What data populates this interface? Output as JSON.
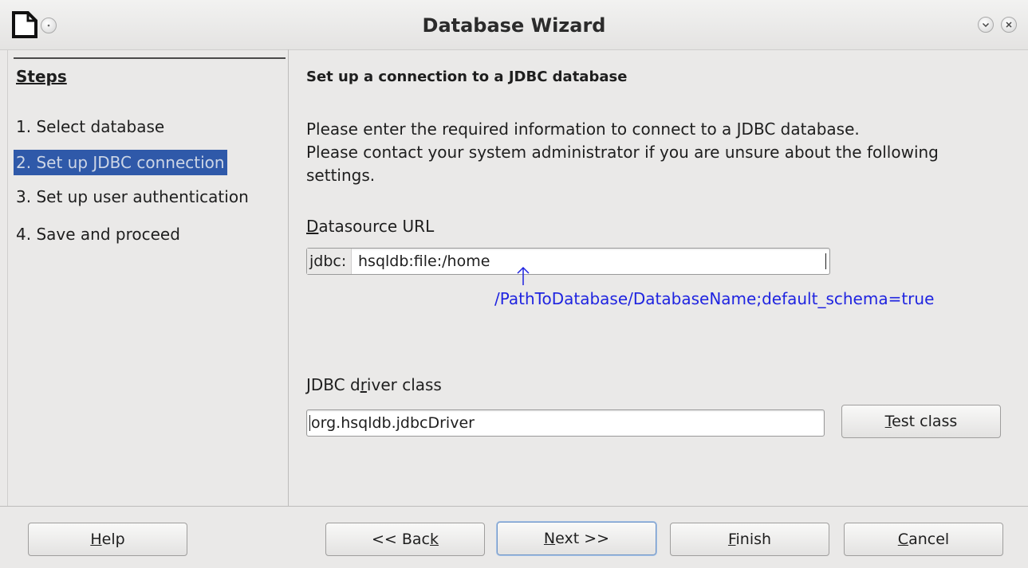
{
  "window": {
    "title": "Database Wizard"
  },
  "steps": {
    "heading": "Steps",
    "items": [
      {
        "label": "1. Select database"
      },
      {
        "label": "2. Set up JDBC connection",
        "selected": true
      },
      {
        "label": "3. Set up user authentication"
      },
      {
        "label": "4. Save and proceed"
      }
    ]
  },
  "panel": {
    "heading": "Set up a connection to a JDBC database",
    "intro_line1": "Please enter the required information to connect to a JDBC database.",
    "intro_line2": "Please contact your system administrator if you are unsure about the following",
    "intro_line3": "settings."
  },
  "datasource": {
    "label_mnemonic": "D",
    "label_rest": "atasource URL",
    "prefix": "jdbc:",
    "value": "hsqldb:file:/home",
    "annotation": "/PathToDatabase/DatabaseName;default_schema=true"
  },
  "driver": {
    "label_pre": "JDBC d",
    "label_mnemonic": "r",
    "label_post": "iver class",
    "value": "org.hsqldb.jdbcDriver",
    "test_mnemonic": "T",
    "test_rest": "est class"
  },
  "buttons": {
    "help_mnemonic": "H",
    "help_rest": "elp",
    "back_pre": "<< Bac",
    "back_mnemonic": "k",
    "next_mnemonic": "N",
    "next_rest": "ext >>",
    "finish_mnemonic": "F",
    "finish_rest": "inish",
    "cancel_mnemonic": "C",
    "cancel_rest": "ancel"
  },
  "colors": {
    "selection": "#2f59a9",
    "annotation": "#1f24e0",
    "window_bg": "#eae9e8"
  }
}
